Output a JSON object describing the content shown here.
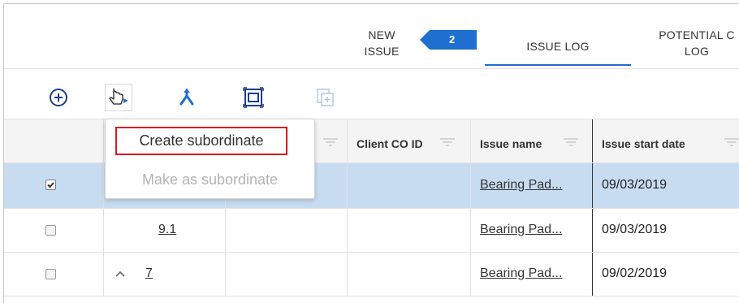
{
  "tabs": {
    "new_issue_line1": "NEW",
    "new_issue_line2": "ISSUE",
    "badge_count": "2",
    "issue_log": "ISSUE LOG",
    "potential_line1": "POTENTIAL C",
    "potential_line2": "LOG"
  },
  "toolbar": {
    "icons": [
      "plus-circle-icon",
      "move-pointer-icon",
      "branch-icon",
      "frame-icon",
      "copy-icon"
    ]
  },
  "menu": {
    "create_subordinate": "Create subordinate",
    "make_as_subordinate": "Make as subordinate"
  },
  "grid": {
    "headers": {
      "client_co_id": "Client CO ID",
      "issue_name": "Issue name",
      "issue_start_date": "Issue start date"
    },
    "rows": [
      {
        "checked": true,
        "id": "",
        "issue_name": "Bearing Pad...",
        "start_date": "09/03/2019"
      },
      {
        "checked": false,
        "id": "9.1",
        "issue_name": "Bearing Pad...",
        "start_date": "09/03/2019"
      },
      {
        "checked": false,
        "id": "7",
        "issue_name": "Bearing Pad...",
        "start_date": "09/02/2019"
      }
    ]
  },
  "colors": {
    "accent": "#1e6fd0",
    "selected_row": "#c7dcf1",
    "highlight_border": "#e0141b"
  }
}
